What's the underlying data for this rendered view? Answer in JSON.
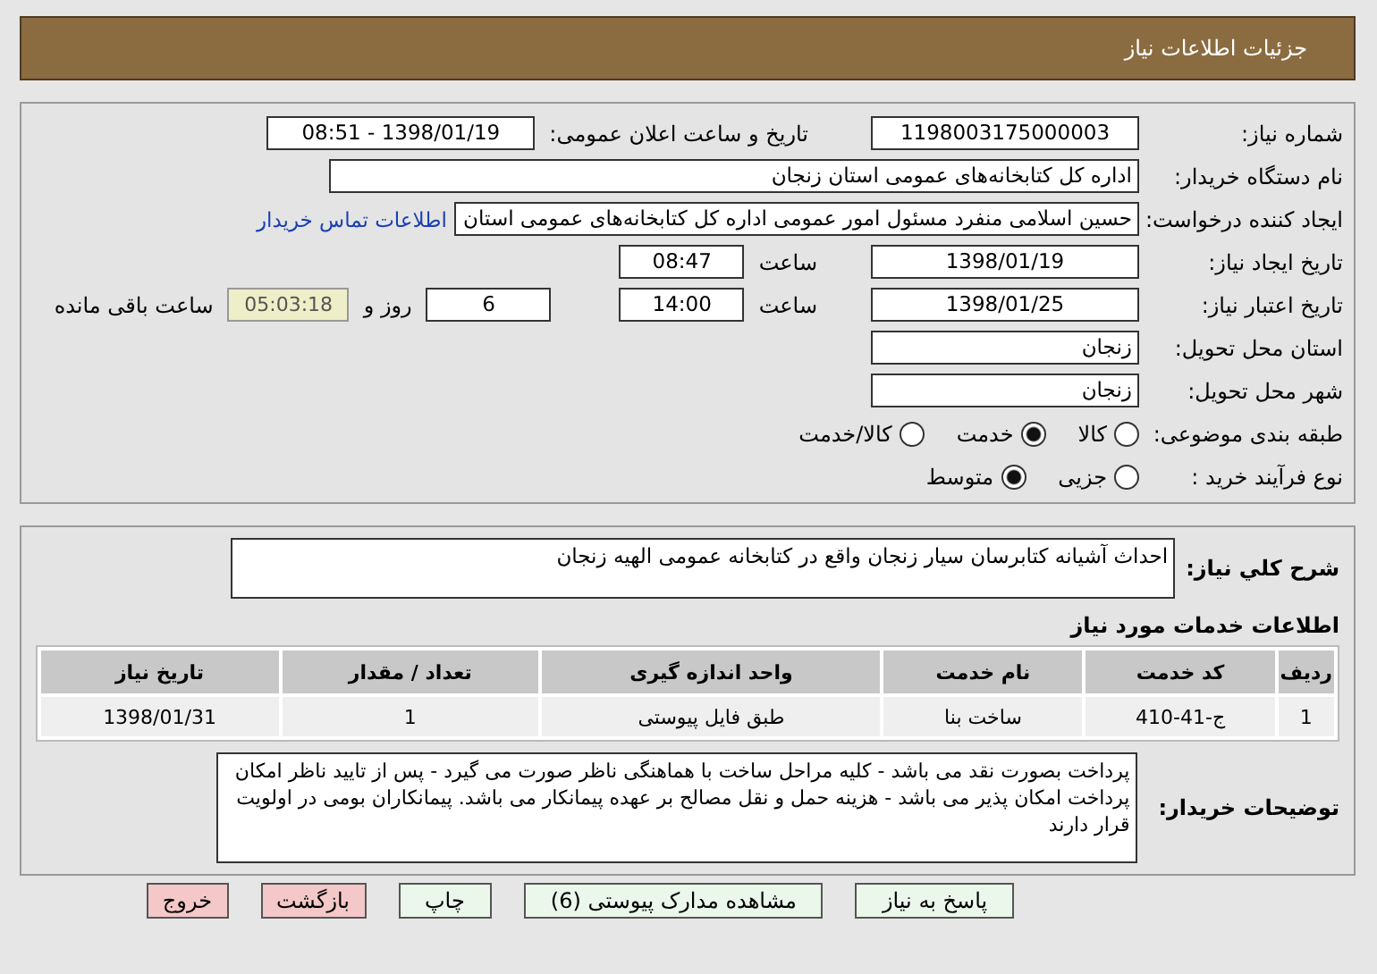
{
  "header": {
    "title": "جزئیات اطلاعات نیاز"
  },
  "details": {
    "need_number": {
      "label": "شماره نیاز:",
      "value": "1198003175000003"
    },
    "announce": {
      "label": "تاریخ و ساعت اعلان عمومی:",
      "value": "1398/01/19 - 08:51"
    },
    "buyer": {
      "label": "نام دستگاه خریدار:",
      "value": "اداره کل کتابخانه‌های عمومی استان زنجان"
    },
    "creator": {
      "label": "ایجاد کننده درخواست:",
      "value": "حسین اسلامی منفرد مسئول امور عمومی اداره کل کتابخانه‌های عمومی استان",
      "link": "اطلاعات تماس خریدار"
    },
    "created": {
      "label": "تاریخ ایجاد نیاز:",
      "date": "1398/01/19",
      "time_label": "ساعت",
      "time": "08:47"
    },
    "validity": {
      "label": "تاریخ اعتبار نیاز:",
      "date": "1398/01/25",
      "time_label": "ساعت",
      "time": "14:00",
      "days": "6",
      "days_label": "روز و",
      "remaining": "05:03:18",
      "remaining_label": "ساعت باقی مانده"
    },
    "province": {
      "label": "استان محل تحویل:",
      "value": "زنجان"
    },
    "city": {
      "label": "شهر محل تحویل:",
      "value": "زنجان"
    },
    "category": {
      "label": "طبقه بندی موضوعی:",
      "options": [
        {
          "label": "کالا",
          "selected": false
        },
        {
          "label": "خدمت",
          "selected": true
        },
        {
          "label": "کالا/خدمت",
          "selected": false
        }
      ]
    },
    "process": {
      "label": "نوع فرآیند خرید :",
      "options": [
        {
          "label": "جزیی",
          "selected": false
        },
        {
          "label": "متوسط",
          "selected": true
        }
      ]
    }
  },
  "summary": {
    "label": "شرح کلي نیاز:",
    "value": "احداث آشیانه کتابرسان سیار زنجان واقع در کتابخانه عمومی الهیه زنجان"
  },
  "services": {
    "title": "اطلاعات خدمات مورد نیاز",
    "columns": [
      "ردیف",
      "کد خدمت",
      "نام خدمت",
      "واحد اندازه گیری",
      "تعداد / مقدار",
      "تاریخ نیاز"
    ],
    "rows": [
      [
        "1",
        "ج-41-410",
        "ساخت بنا",
        "طبق فایل پیوستی",
        "1",
        "1398/01/31"
      ]
    ]
  },
  "notes": {
    "label": "توضیحات خریدار:",
    "value": "پرداخت بصورت نقد می باشد - کلیه مراحل ساخت با هماهنگی ناظر صورت می گیرد - پس از تایید ناظر امکان پرداخت امکان پذیر می باشد - هزینه حمل و نقل مصالح بر عهده پیمانکار می باشد. پیمانکاران بومی در اولویت قرار دارند"
  },
  "buttons": [
    {
      "label": "پاسخ به نیاز",
      "kind": "normal"
    },
    {
      "label": "مشاهده مدارک پیوستی (6)",
      "kind": "normal"
    },
    {
      "label": "چاپ",
      "kind": "normal"
    },
    {
      "label": "بازگشت",
      "kind": "danger"
    },
    {
      "label": "خروج",
      "kind": "danger"
    }
  ]
}
